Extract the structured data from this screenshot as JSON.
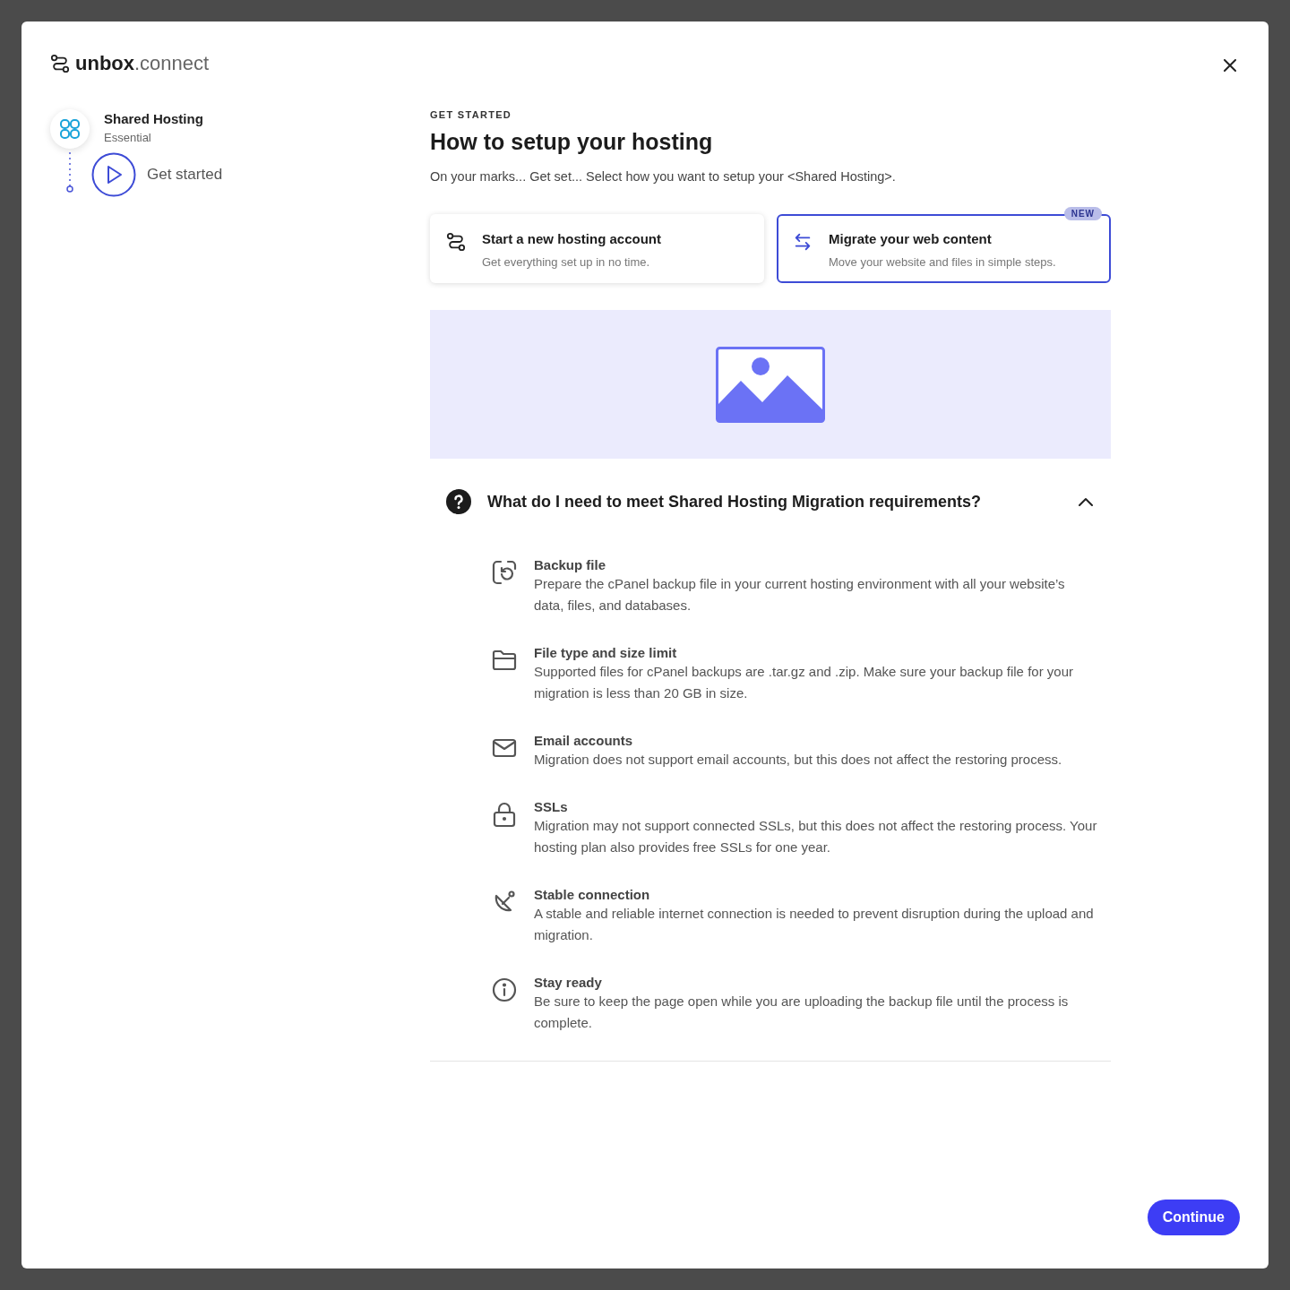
{
  "logo": {
    "text": "**unbox**.connect"
  },
  "steps": [
    {
      "title": "Shared Hosting",
      "subtitle": "Essential",
      "kind": "product"
    },
    {
      "title": "Get started",
      "kind": "current"
    }
  ],
  "eyebrow": "GET STARTED",
  "heading": "How to setup your hosting",
  "intro": "On your marks... Get set... Select how you want to setup your <Shared Hosting>.",
  "options": [
    {
      "title": "Start a new hosting account",
      "description": "Get everything set up in no time.",
      "kind": "new",
      "selected": false
    },
    {
      "title": "Migrate your web content",
      "description": "Move your website and files in simple steps.",
      "kind": "migrate",
      "selected": true,
      "badge": "NEW"
    }
  ],
  "faq": {
    "question": "What do I need to meet Shared Hosting Migration requirements?",
    "expanded": true,
    "items": [
      {
        "kind": "backup",
        "title": "Backup file",
        "description": "Prepare the cPanel backup file in your current hosting environment with all your website’s data, files, and databases."
      },
      {
        "kind": "folder",
        "title": "File type and size limit",
        "description": "Supported files for cPanel backups are .tar.gz and .zip. Make sure your backup file for your migration is less than 20 GB in size."
      },
      {
        "kind": "email",
        "title": "Email accounts",
        "description": "Migration does not support email accounts, but this does not affect the restoring process."
      },
      {
        "kind": "lock",
        "title": "SSLs",
        "description": "Migration may not support connected SSLs, but this does not affect the restoring process. Your hosting plan also provides free SSLs for one year."
      },
      {
        "kind": "satellite",
        "title": "Stable connection",
        "description": "A stable and reliable internet connection is needed to prevent disruption during the upload and migration."
      },
      {
        "kind": "info",
        "title": "Stay ready",
        "description": "Be sure to keep the page open while you are uploading the backup file until the process is complete."
      }
    ]
  },
  "continue_button": "Continue"
}
